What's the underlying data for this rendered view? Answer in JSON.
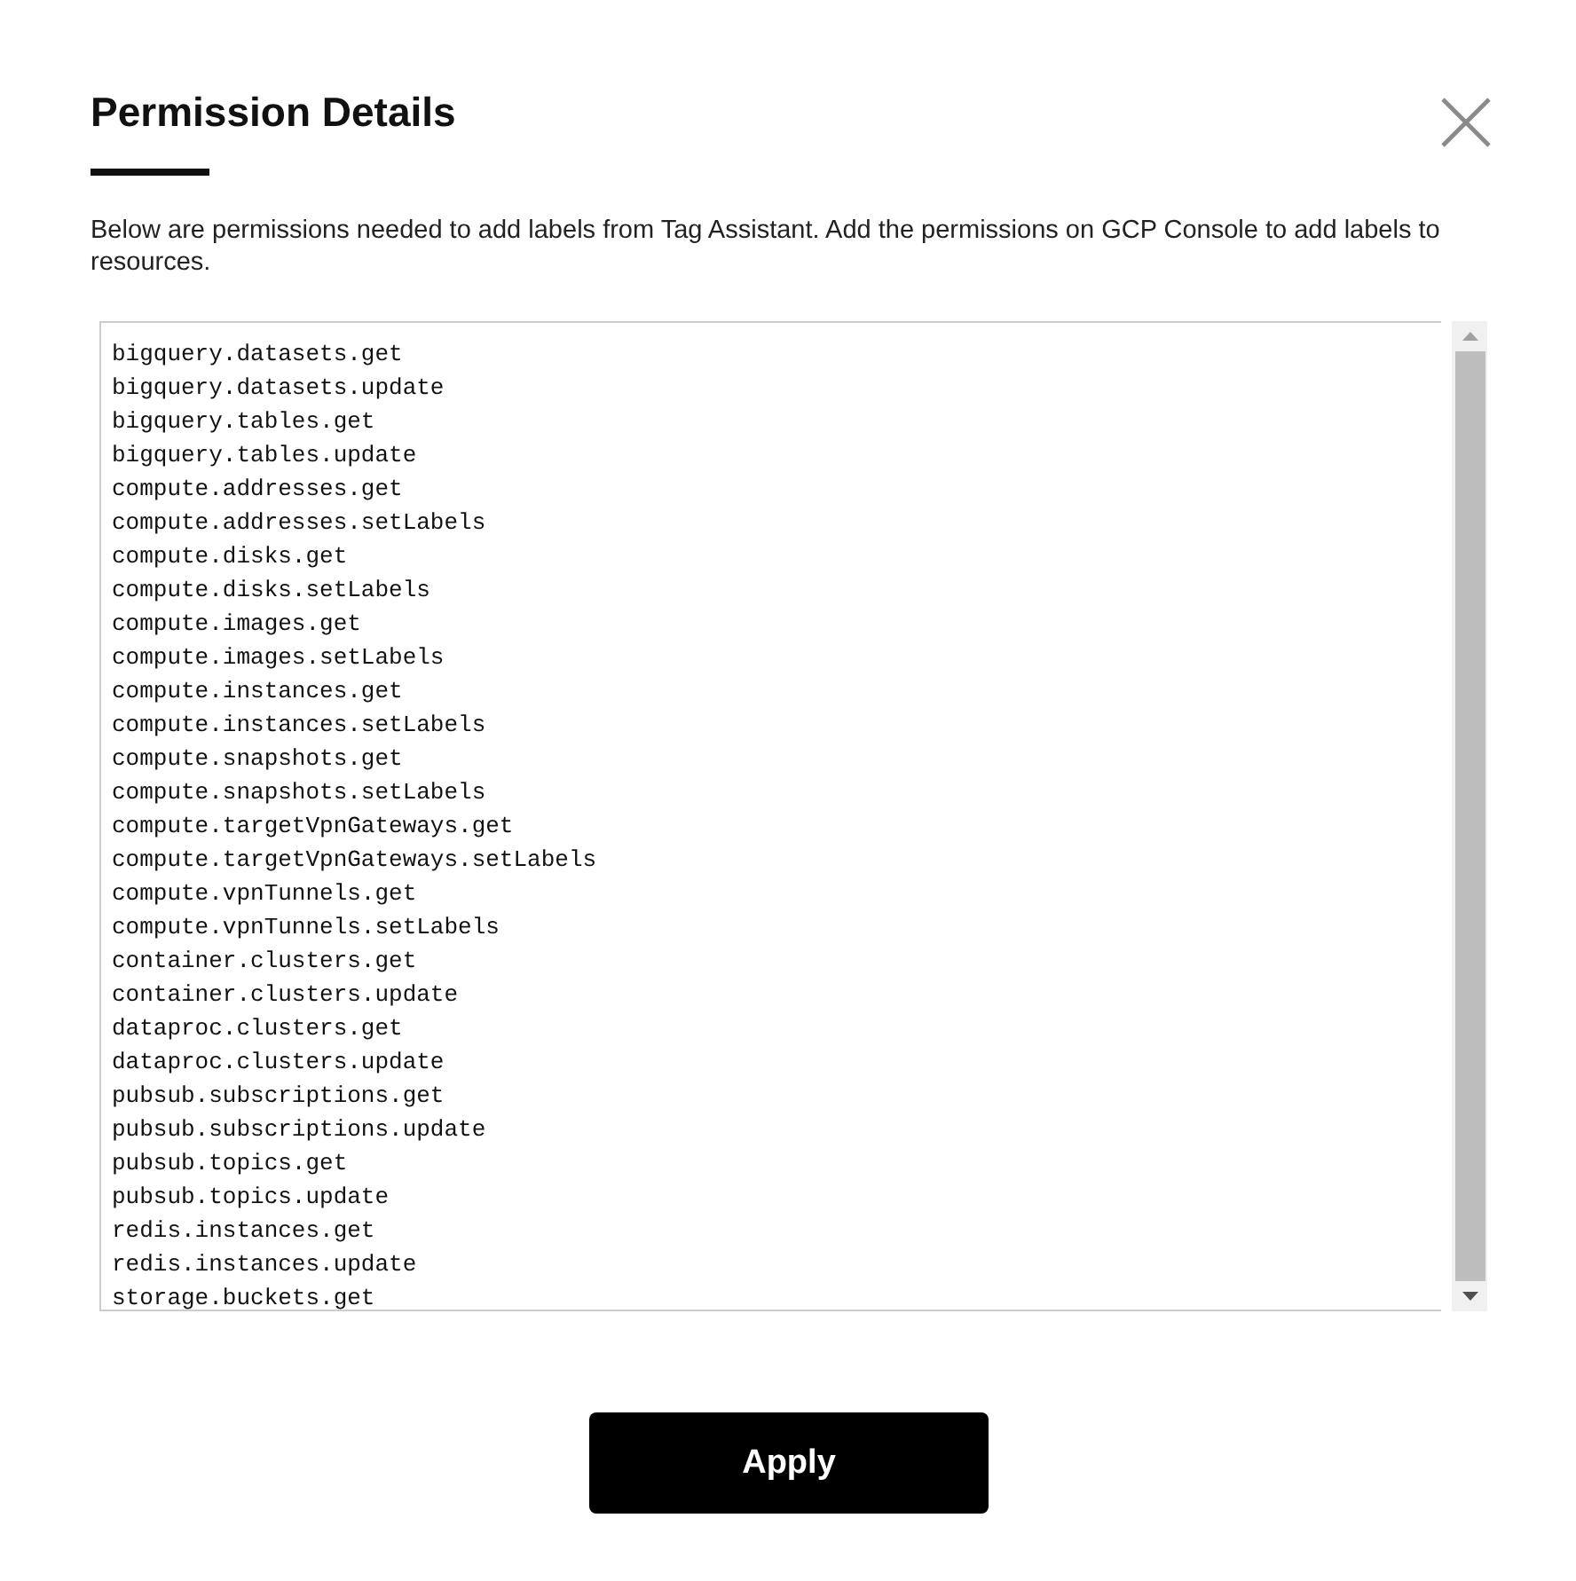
{
  "dialog": {
    "title": "Permission Details",
    "description": "Below are permissions needed to add labels from Tag Assistant. Add the permissions on GCP Console to add labels to resources.",
    "permissions": [
      "bigquery.datasets.get",
      "bigquery.datasets.update",
      "bigquery.tables.get",
      "bigquery.tables.update",
      "compute.addresses.get",
      "compute.addresses.setLabels",
      "compute.disks.get",
      "compute.disks.setLabels",
      "compute.images.get",
      "compute.images.setLabels",
      "compute.instances.get",
      "compute.instances.setLabels",
      "compute.snapshots.get",
      "compute.snapshots.setLabels",
      "compute.targetVpnGateways.get",
      "compute.targetVpnGateways.setLabels",
      "compute.vpnTunnels.get",
      "compute.vpnTunnels.setLabels",
      "container.clusters.get",
      "container.clusters.update",
      "dataproc.clusters.get",
      "dataproc.clusters.update",
      "pubsub.subscriptions.get",
      "pubsub.subscriptions.update",
      "pubsub.topics.get",
      "pubsub.topics.update",
      "redis.instances.get",
      "redis.instances.update",
      "storage.buckets.get"
    ],
    "button": "Apply"
  }
}
